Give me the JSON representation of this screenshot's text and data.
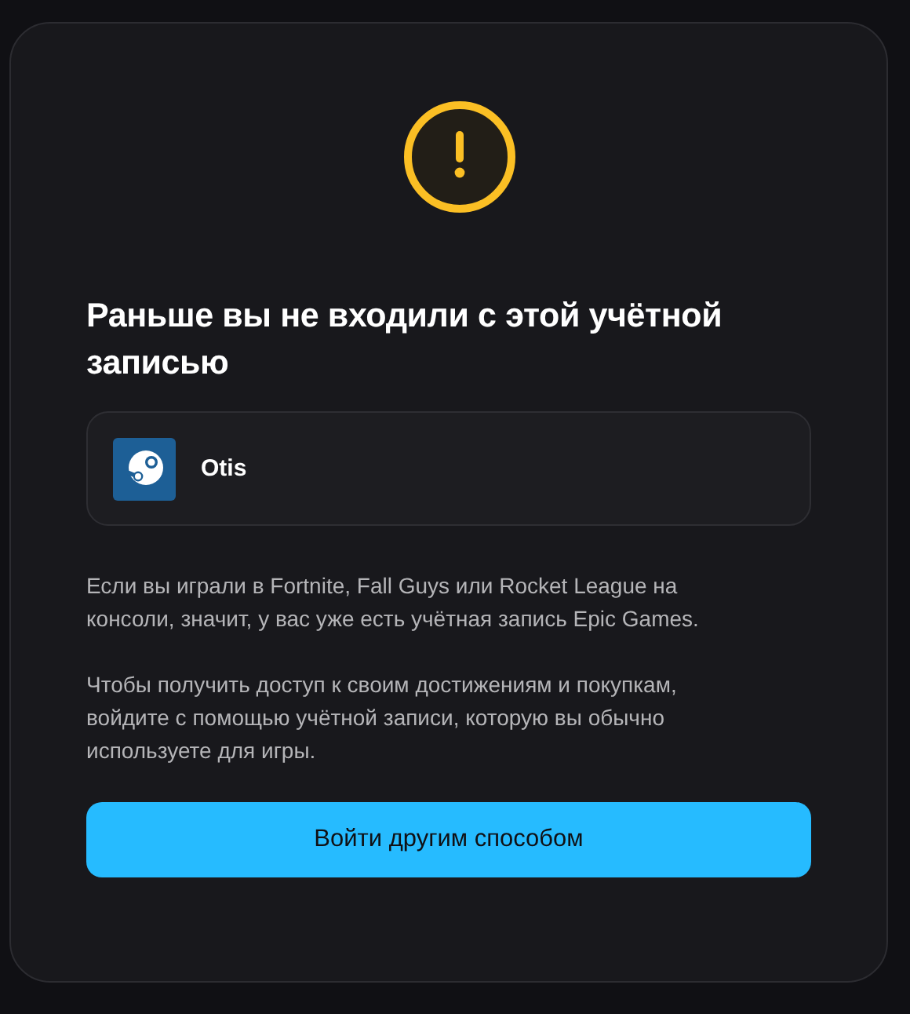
{
  "dialog": {
    "title": "Раньше вы не входили с этой учётной записью",
    "account": {
      "name": "Otis"
    },
    "paragraphs": [
      "Если вы играли в Fortnite, Fall Guys или Rocket League на консоли, значит, у вас уже есть учётная запись Epic Games.",
      "Чтобы получить доступ к своим достижениям и покупкам, войдите с помощью учётной записи, которую вы обычно используете для игры."
    ],
    "button": "Войти другим способом"
  }
}
